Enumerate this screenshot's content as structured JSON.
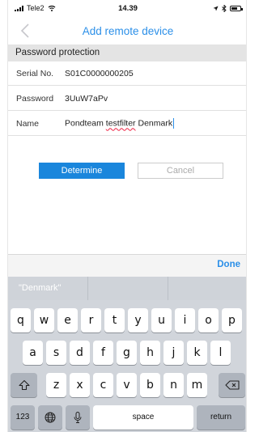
{
  "status_bar": {
    "carrier": "Tele2",
    "time": "14.39"
  },
  "nav": {
    "title": "Add remote device",
    "back_icon": "chevron-left-icon"
  },
  "section": {
    "header": "Password protection"
  },
  "form": {
    "serial_label": "Serial No.",
    "serial_value": "S01C0000000205",
    "password_label": "Password",
    "password_value": "3UuW7aPv",
    "name_label": "Name",
    "name_value_part1": "Pondteam",
    "name_value_part2": "testfilter",
    "name_value_part3": "Denmark"
  },
  "buttons": {
    "determine": "Determine",
    "cancel": "Cancel"
  },
  "keyboard": {
    "done_label": "Done",
    "suggestions": [
      "\"Denmark\"",
      "",
      ""
    ],
    "row1": [
      "q",
      "w",
      "e",
      "r",
      "t",
      "y",
      "u",
      "i",
      "o",
      "p"
    ],
    "row2": [
      "a",
      "s",
      "d",
      "f",
      "g",
      "h",
      "j",
      "k",
      "l"
    ],
    "row3": [
      "z",
      "x",
      "c",
      "v",
      "b",
      "n",
      "m"
    ],
    "numbers_label": "123",
    "space_label": "space",
    "return_label": "return"
  },
  "colors": {
    "accent": "#2b8fe8",
    "primary_button": "#1a86dc",
    "section_header_bg": "#e4e4e4",
    "keyboard_bg": "#d1d5db"
  }
}
